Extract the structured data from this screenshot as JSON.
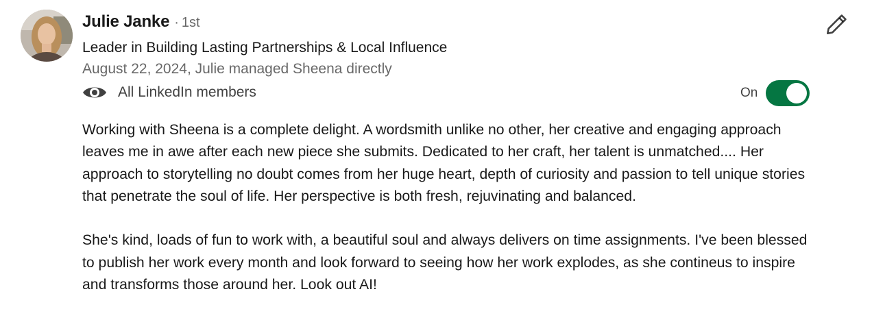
{
  "recommendation": {
    "author": {
      "name": "Julie Janke",
      "separator": "·",
      "degree": "1st",
      "headline": "Leader in Building Lasting Partnerships & Local Influence",
      "avatar_icon": "profile-photo"
    },
    "meta": "August 22, 2024, Julie managed Sheena directly",
    "visibility": {
      "icon": "eye-icon",
      "label": "All LinkedIn members"
    },
    "toggle": {
      "label": "On",
      "state": "on",
      "color": "#057642"
    },
    "edit": {
      "icon": "pencil-icon"
    },
    "paragraphs": [
      "Working with Sheena is a complete delight. A wordsmith unlike no other, her creative and engaging approach leaves me in awe after each new piece she submits. Dedicated to her craft, her talent is unmatched.... Her approach to storytelling no doubt comes from her huge heart, depth of curiosity and passion to tell unique stories that penetrate the soul of life. Her perspective is both fresh, rejuvinating and balanced.",
      "She's kind, loads of fun to work with, a beautiful soul and always delivers on time assignments. I've been blessed to publish her work every month and look forward to seeing how her work explodes, as she contineus to inspire and transforms those around her. Look out AI!"
    ]
  }
}
